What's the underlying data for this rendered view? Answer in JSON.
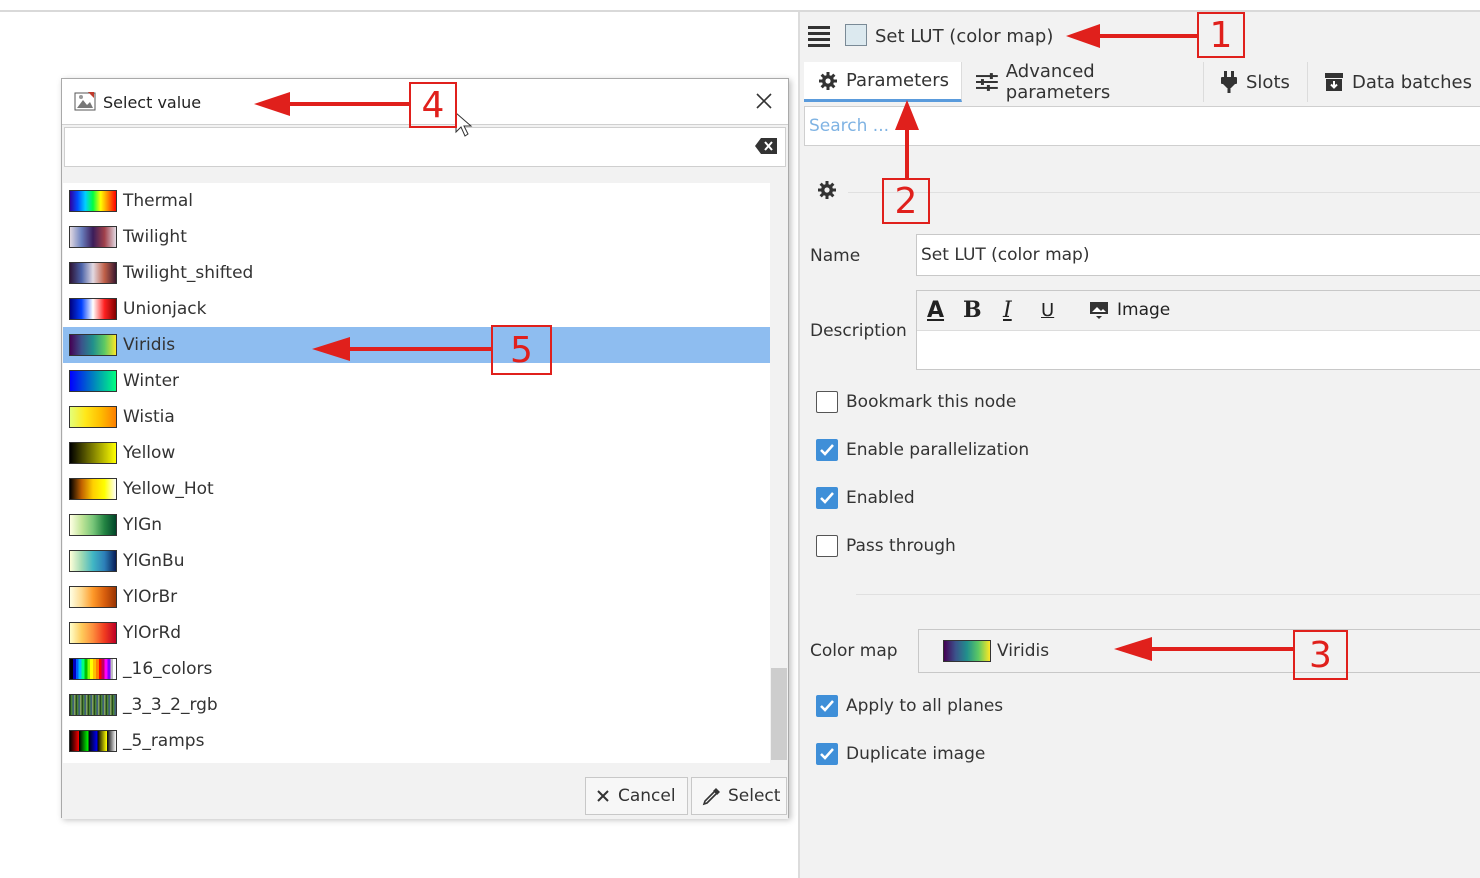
{
  "node": {
    "title": "Set LUT (color map)"
  },
  "tabs": [
    {
      "label": "Parameters"
    },
    {
      "label": "Advanced parameters"
    },
    {
      "label": "Slots"
    },
    {
      "label": "Data batches"
    }
  ],
  "search": {
    "placeholder": "Search ..."
  },
  "form": {
    "name_label": "Name",
    "name_value": "Set LUT (color map)",
    "description_label": "Description",
    "image_button": "Image",
    "checkboxes_top": [
      {
        "label": "Bookmark this node",
        "checked": false
      },
      {
        "label": "Enable parallelization",
        "checked": true
      },
      {
        "label": "Enabled",
        "checked": true
      },
      {
        "label": "Pass through",
        "checked": false
      }
    ],
    "colormap_label": "Color map",
    "colormap_value": "Viridis",
    "checkboxes_bottom": [
      {
        "label": "Apply to all planes",
        "checked": true
      },
      {
        "label": "Duplicate image",
        "checked": true
      }
    ]
  },
  "dialog": {
    "title": "Select value",
    "items": [
      {
        "label": "Thermal"
      },
      {
        "label": "Twilight"
      },
      {
        "label": "Twilight_shifted"
      },
      {
        "label": "Unionjack"
      },
      {
        "label": "Viridis",
        "selected": true
      },
      {
        "label": "Winter"
      },
      {
        "label": "Wistia"
      },
      {
        "label": "Yellow"
      },
      {
        "label": "Yellow_Hot"
      },
      {
        "label": "YlGn"
      },
      {
        "label": "YlGnBu"
      },
      {
        "label": "YlOrBr"
      },
      {
        "label": "YlOrRd"
      },
      {
        "label": "_16_colors"
      },
      {
        "label": "_3_3_2_rgb"
      },
      {
        "label": "_5_ramps"
      }
    ],
    "cancel_label": "Cancel",
    "select_label": "Select"
  },
  "annotations": [
    "1",
    "2",
    "3",
    "4",
    "5"
  ],
  "colors": {
    "accent": "#5a9bdc",
    "selection": "#8ebdf0",
    "checkbox": "#3f8fd8",
    "annotation": "#e0201c"
  }
}
